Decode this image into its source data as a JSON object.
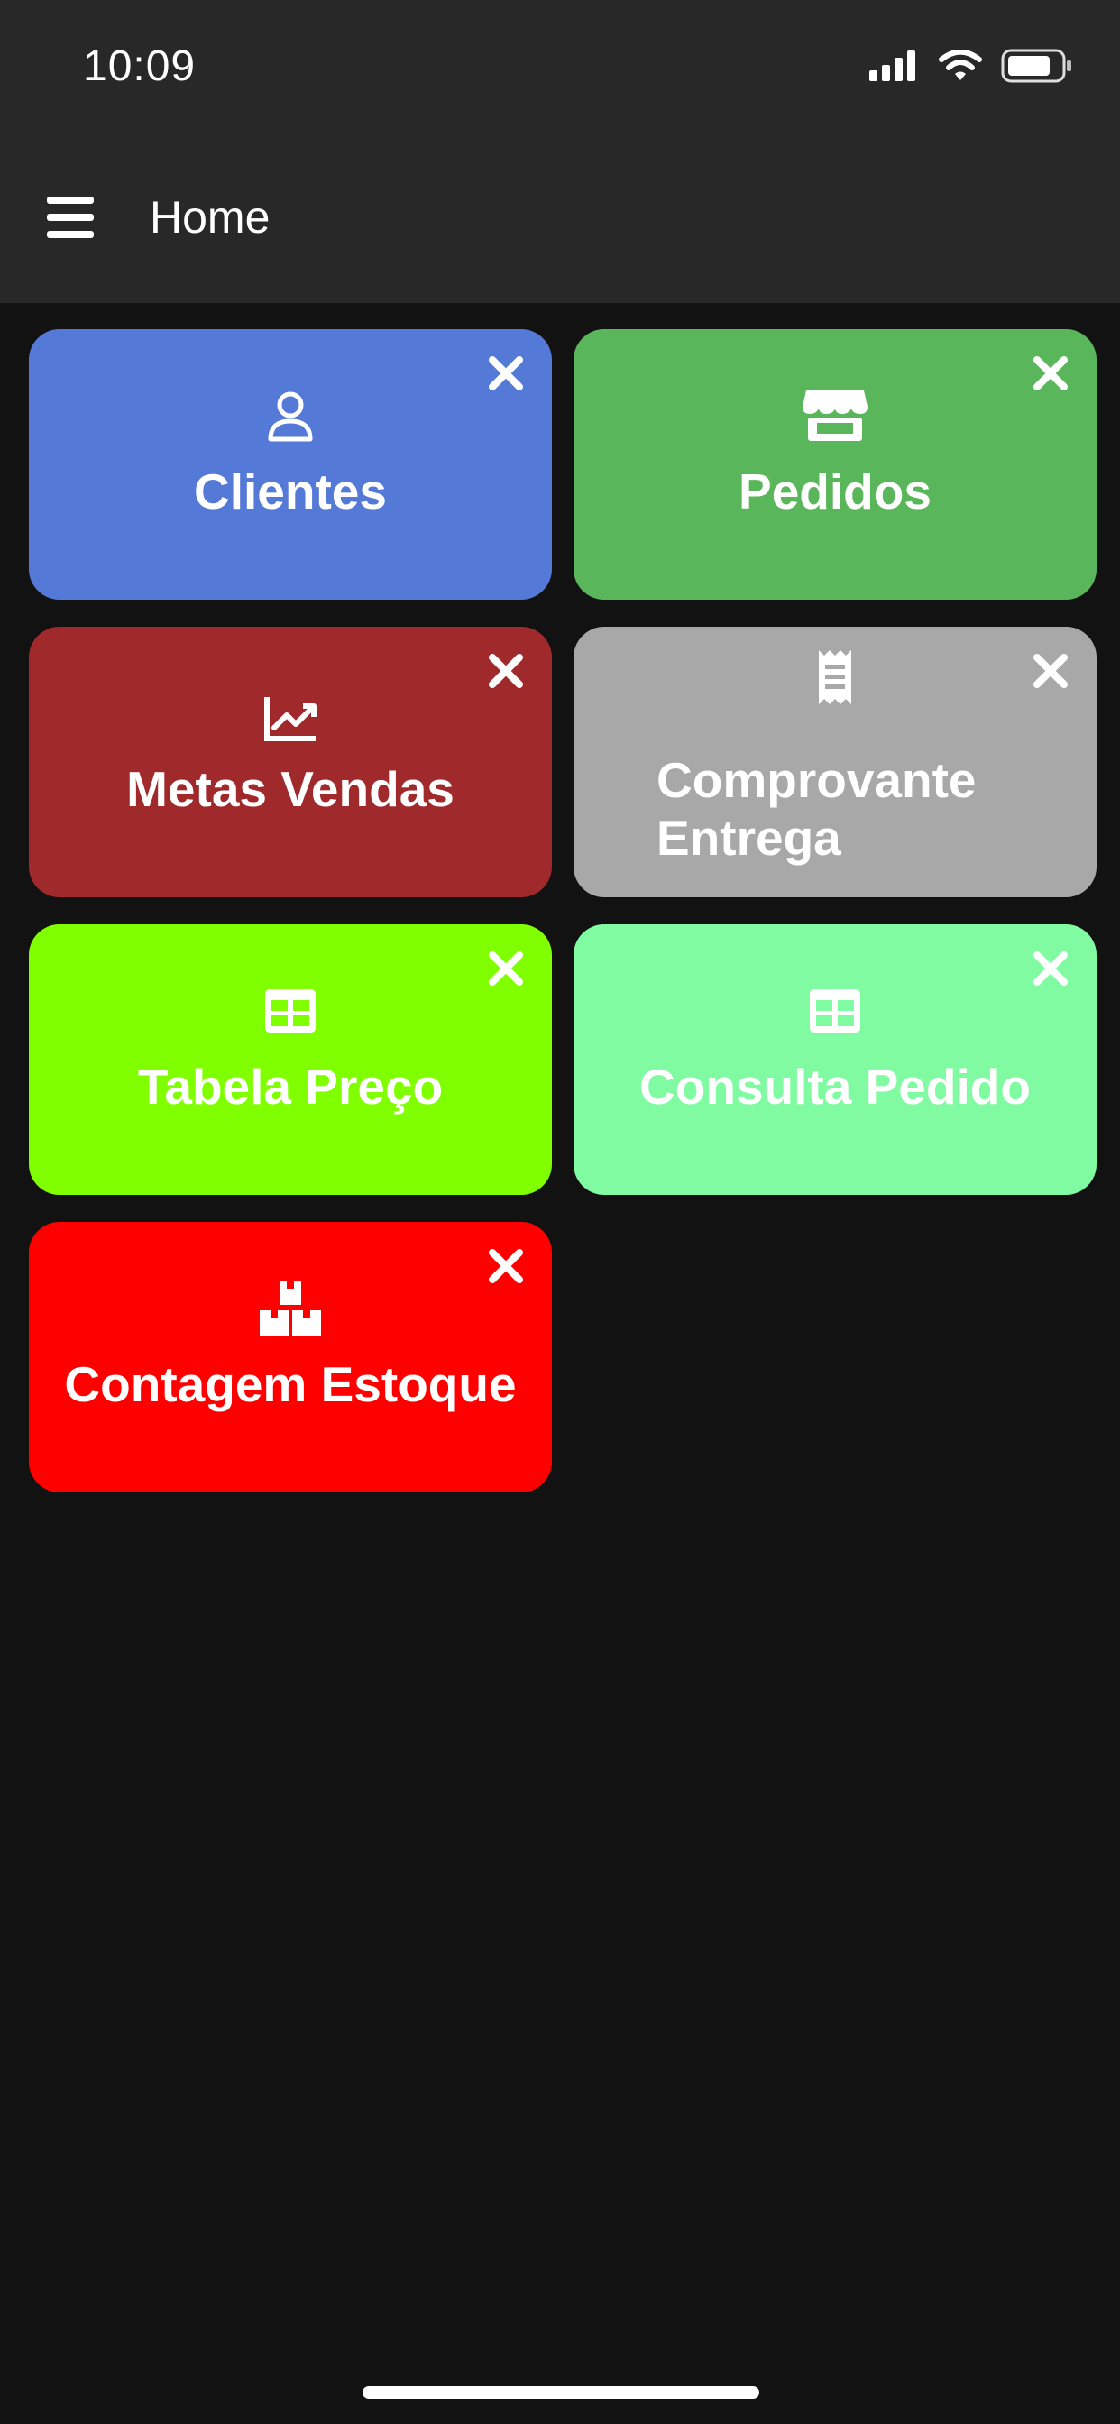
{
  "status_bar": {
    "time": "10:09",
    "icons": [
      "signal-icon",
      "wifi-icon",
      "battery-icon"
    ]
  },
  "app_bar": {
    "title": "Home",
    "menu_icon": "menu-icon"
  },
  "tiles": [
    {
      "label": "Clientes",
      "icon": "user-icon",
      "color": "#5479D6"
    },
    {
      "label": "Pedidos",
      "icon": "store-icon",
      "color": "#5AB65A"
    },
    {
      "label": "Metas Vendas",
      "icon": "chart-line-icon",
      "color": "#A0292C"
    },
    {
      "label": "Comprovante Entrega",
      "icon": "receipt-icon",
      "color": "#A8A8A8"
    },
    {
      "label": "Tabela Preço",
      "icon": "table-icon",
      "color": "#80FF00"
    },
    {
      "label": "Consulta Pedido",
      "icon": "table-icon",
      "color": "#80FBA2"
    },
    {
      "label": "Contagem Estoque",
      "icon": "boxes-icon",
      "color": "#FF0000"
    }
  ],
  "close_icon": "close-icon"
}
